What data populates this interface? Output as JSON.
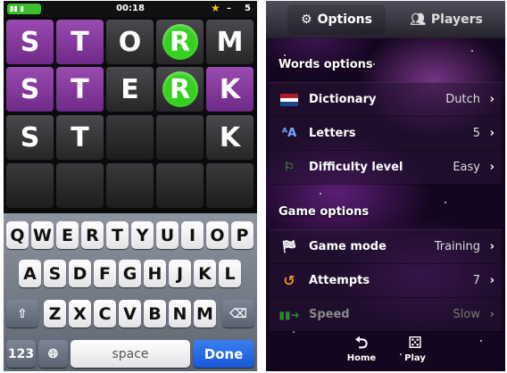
{
  "left": {
    "status": {
      "clock": "00:18",
      "score": "5",
      "dash": "–"
    },
    "board": {
      "rows": [
        [
          "S",
          "T",
          "O",
          "R",
          "M"
        ],
        [
          "S",
          "T",
          "E",
          "R",
          "K"
        ],
        [
          "S",
          "T",
          "",
          "",
          "K"
        ],
        [
          "",
          "",
          "",
          "",
          ""
        ]
      ]
    },
    "keyboard": {
      "row1": [
        "Q",
        "W",
        "E",
        "R",
        "T",
        "Y",
        "U",
        "I",
        "O",
        "P"
      ],
      "row2": [
        "A",
        "S",
        "D",
        "F",
        "G",
        "H",
        "J",
        "K",
        "L"
      ],
      "row3": [
        "Z",
        "X",
        "C",
        "V",
        "B",
        "N",
        "M"
      ],
      "numbers_label": "123",
      "space_label": "space",
      "done_label": "Done"
    }
  },
  "right": {
    "tabs": {
      "options": "Options",
      "players": "Players"
    },
    "words_title": "Words options",
    "words_rows": [
      {
        "label": "Dictionary",
        "value": "Dutch",
        "icon": "netherlands-flag-icon"
      },
      {
        "label": "Letters",
        "value": "5",
        "icon": "letters-icon"
      },
      {
        "label": "Difficulty level",
        "value": "Easy",
        "icon": "flag-icon"
      }
    ],
    "game_title": "Game options",
    "game_rows": [
      {
        "label": "Game mode",
        "value": "Training",
        "icon": "checkered-flag-icon"
      },
      {
        "label": "Attempts",
        "value": "7",
        "icon": "refresh-icon"
      },
      {
        "label": "Speed",
        "value": "Slow",
        "icon": "speed-arrow-icon"
      }
    ],
    "home_label": "Home",
    "play_label": "Play"
  }
}
